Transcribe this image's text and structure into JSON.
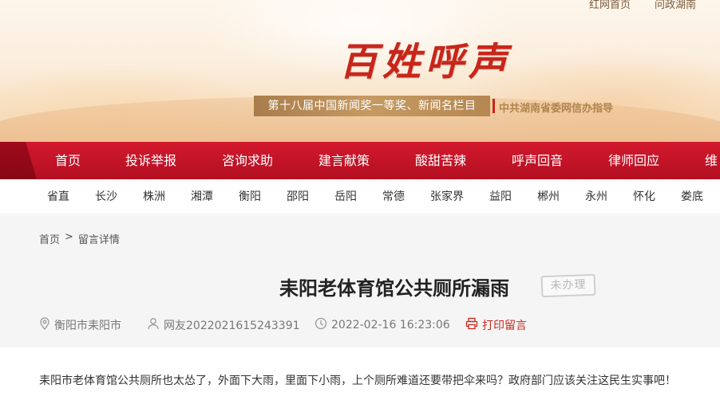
{
  "top_links": [
    "红网首页",
    "问政湖南"
  ],
  "logo": {
    "title": "百姓呼声"
  },
  "award": {
    "text": "第十八届中国新闻奖一等奖、新闻名栏目",
    "note": "中共湖南省委网信办指导"
  },
  "nav": {
    "items": [
      "首页",
      "投诉举报",
      "咨询求助",
      "建言献策",
      "酸甜苦辣",
      "呼声回音",
      "律师回应",
      "维"
    ]
  },
  "regions": [
    "省直",
    "长沙",
    "株洲",
    "湘潭",
    "衡阳",
    "邵阳",
    "岳阳",
    "常德",
    "张家界",
    "益阳",
    "郴州",
    "永州",
    "怀化",
    "娄底"
  ],
  "breadcrumb": {
    "home": "首页",
    "sep": ">",
    "current": "留言详情"
  },
  "post": {
    "title": "耒阳老体育馆公共厕所漏雨",
    "status": "未办理",
    "location": "衡阳市耒阳市",
    "author": "网友2022021615243391",
    "time": "2022-02-16 16:23:06",
    "print": "打印留言",
    "content": "耒阳市老体育馆公共厕所也太怂了，外面下大雨，里面下小雨，上个厕所难道还要带把伞来吗？政府部门应该关注这民生实事吧！"
  },
  "colors": {
    "brand_red": "#c8261b",
    "nav_red": "#c0142a",
    "award_gold": "#b58752"
  },
  "icons": {
    "location": "location-pin-icon",
    "user": "user-icon",
    "time": "clock-icon",
    "print": "printer-icon"
  }
}
